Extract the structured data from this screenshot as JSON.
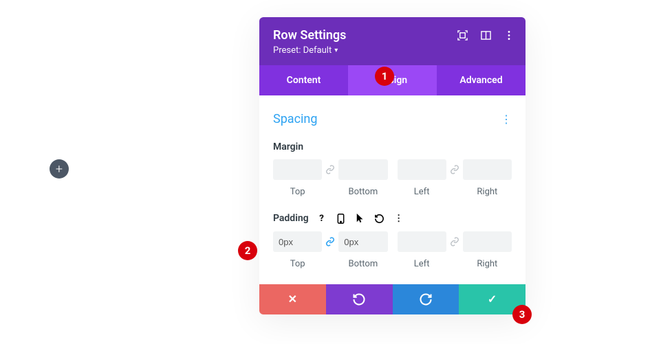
{
  "add_button": {
    "glyph": "+"
  },
  "modal": {
    "title": "Row Settings",
    "preset_label": "Preset: Default"
  },
  "tabs": {
    "content": "Content",
    "design": "Design",
    "advanced": "Advanced"
  },
  "section": {
    "title": "Spacing"
  },
  "margin": {
    "label": "Margin",
    "top": {
      "value": "",
      "label": "Top"
    },
    "bottom": {
      "value": "",
      "label": "Bottom"
    },
    "left": {
      "value": "",
      "label": "Left"
    },
    "right": {
      "value": "",
      "label": "Right"
    }
  },
  "padding": {
    "label": "Padding",
    "top": {
      "value": "0px",
      "label": "Top"
    },
    "bottom": {
      "value": "0px",
      "label": "Bottom"
    },
    "left": {
      "value": "",
      "label": "Left"
    },
    "right": {
      "value": "",
      "label": "Right"
    }
  },
  "footer": {
    "cancel_glyph": "✕",
    "undo_glyph": "↺",
    "redo_glyph": "↻",
    "save_glyph": "✓"
  },
  "annotations": {
    "a1": "1",
    "a2": "2",
    "a3": "3"
  },
  "option_icons": {
    "help": "?",
    "kebab": "⋮"
  }
}
